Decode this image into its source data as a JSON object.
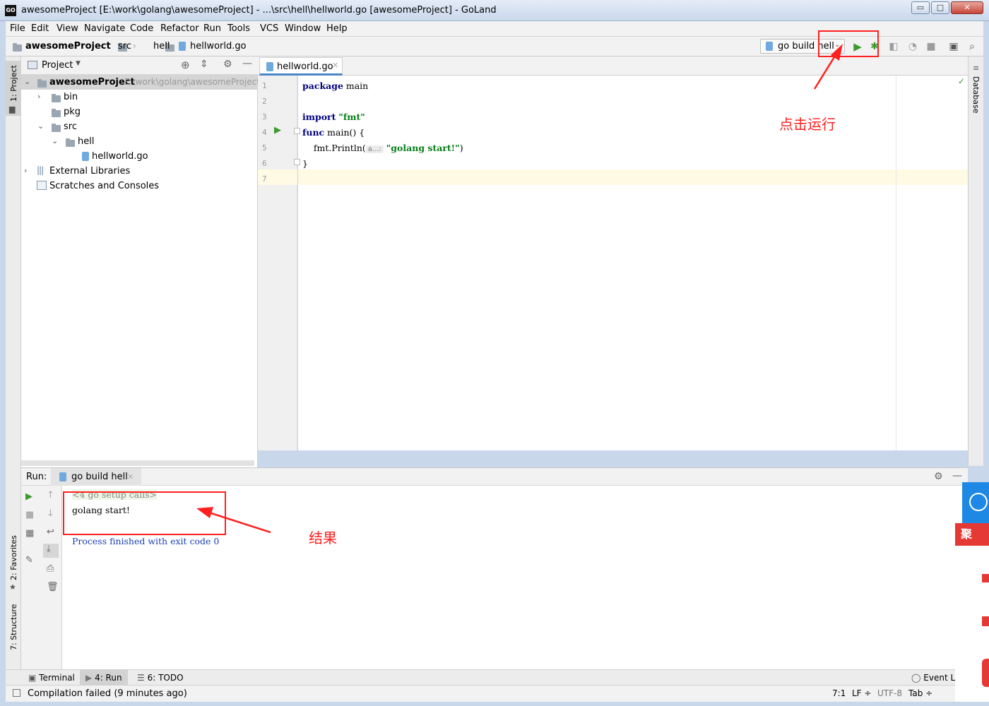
{
  "window": {
    "title": "awesomeProject [E:\\work\\golang\\awesomeProject] - ...\\src\\hell\\hellworld.go [awesomeProject] - GoLand",
    "app_logo": "GO",
    "controls": [
      "▭",
      "□",
      "✕"
    ]
  },
  "menu": [
    "File",
    "Edit",
    "View",
    "Navigate",
    "Code",
    "Refactor",
    "Run",
    "Tools",
    "VCS",
    "Window",
    "Help"
  ],
  "breadcrumb": [
    "awesomeProject",
    "src",
    "hell",
    "hellworld.go"
  ],
  "toolbar": {
    "run_config": "go build hell"
  },
  "left_stripe": {
    "project": "1: Project",
    "favorites": "2: Favorites",
    "structure": "7: Structure"
  },
  "right_stripe": {
    "database": "Database"
  },
  "project_panel": {
    "title": "Project",
    "tree": [
      {
        "label": "awesomeProject",
        "path": "E:\\work\\golang\\awesomeProject"
      },
      {
        "label": "bin"
      },
      {
        "label": "pkg"
      },
      {
        "label": "src"
      },
      {
        "label": "hell"
      },
      {
        "label": "hellworld.go"
      },
      {
        "label": "External Libraries"
      },
      {
        "label": "Scratches and Consoles"
      }
    ]
  },
  "editor": {
    "tab": "hellworld.go",
    "line_numbers": [
      "1",
      "2",
      "3",
      "4",
      "5",
      "6",
      "7"
    ],
    "code": {
      "l1_kw": "package",
      "l1_rest": " main",
      "l3_kw": "import",
      "l3_str": "\"fmt\"",
      "l4_kw": "func",
      "l4_rest": " main() {",
      "l5_pre": "    fmt.Println(",
      "l5_hint": "a...:",
      "l5_str": "\"golang start!\"",
      "l5_post": ")",
      "l6": "}"
    }
  },
  "run_panel": {
    "label": "Run:",
    "tab": "go build hell",
    "console": [
      "<4 go setup calls>",
      "golang start!",
      "",
      "Process finished with exit code 0"
    ]
  },
  "bottom_tabs": [
    "Terminal",
    "4: Run",
    "6: TODO",
    "Event Log"
  ],
  "status": {
    "message": "Compilation failed (9 minutes ago)",
    "position": "7:1",
    "line_sep": "LF ÷",
    "encoding": "UTF-8",
    "indent": "Tab ÷"
  },
  "annotations": {
    "run_hint": "点击运行",
    "result_hint": "结果"
  },
  "overlay": {
    "tag": "聚"
  },
  "colors": {
    "annotation": "#ff2020",
    "run_green": "#3d9a2f",
    "keyword": "#000080",
    "string": "#067d17"
  }
}
